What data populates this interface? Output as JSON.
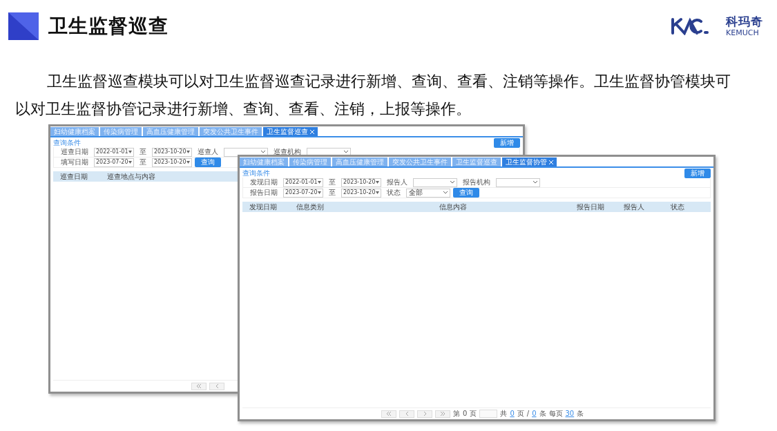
{
  "header": {
    "title": "卫生监督巡查",
    "logo_cn": "科玛奇",
    "logo_en": "KEMUCH"
  },
  "intro": "卫生监督巡查模块可以对卫生监督巡查记录进行新增、查询、查看、注销等操作。卫生监督协管模块可以对卫生监督协管记录进行新增、查询、查看、注销，上报等操作。",
  "windows": [
    {
      "tabs": [
        {
          "label": "妇幼健康档案",
          "selected": false
        },
        {
          "label": "传染病管理",
          "selected": false
        },
        {
          "label": "高血压健康管理",
          "selected": false
        },
        {
          "label": "突发公共卫生事件",
          "selected": false
        },
        {
          "label": "卫生监督巡查",
          "selected": true
        }
      ],
      "section": "查询条件",
      "add_button": "新增",
      "filters": [
        [
          {
            "kind": "label",
            "text": "巡查日期"
          },
          {
            "kind": "date",
            "text": "2022-01-01"
          },
          {
            "kind": "sep",
            "text": "至"
          },
          {
            "kind": "date",
            "text": "2023-10-20"
          },
          {
            "kind": "label",
            "text": "巡查人"
          },
          {
            "kind": "select"
          },
          {
            "kind": "label",
            "text": "巡查机构"
          },
          {
            "kind": "select"
          }
        ],
        [
          {
            "kind": "label",
            "text": "填写日期"
          },
          {
            "kind": "date",
            "text": "2023-07-20"
          },
          {
            "kind": "sep",
            "text": "至"
          },
          {
            "kind": "date",
            "text": "2023-10-20"
          },
          {
            "kind": "button",
            "text": "查询"
          }
        ]
      ],
      "columns": [
        {
          "label": "巡查日期",
          "wide": false
        },
        {
          "label": "巡查地点与内容",
          "wide": false
        }
      ],
      "pager": [
        {
          "kind": "first"
        },
        {
          "kind": "prev"
        }
      ]
    },
    {
      "tabs": [
        {
          "label": "妇幼健康档案",
          "selected": false
        },
        {
          "label": "传染病管理",
          "selected": false
        },
        {
          "label": "高血压健康管理",
          "selected": false
        },
        {
          "label": "突发公共卫生事件",
          "selected": false
        },
        {
          "label": "卫生监督巡查",
          "selected": false
        },
        {
          "label": "卫生监督协管",
          "selected": true
        }
      ],
      "section": "查询条件",
      "add_button": "新增",
      "filters": [
        [
          {
            "kind": "label",
            "text": "发现日期"
          },
          {
            "kind": "date",
            "text": "2022-01-01"
          },
          {
            "kind": "sep",
            "text": "至"
          },
          {
            "kind": "date",
            "text": "2023-10-20"
          },
          {
            "kind": "label",
            "text": "报告人"
          },
          {
            "kind": "select"
          },
          {
            "kind": "label",
            "text": "报告机构"
          },
          {
            "kind": "select"
          }
        ],
        [
          {
            "kind": "label",
            "text": "报告日期"
          },
          {
            "kind": "date",
            "text": "2023-07-20"
          },
          {
            "kind": "sep",
            "text": "至"
          },
          {
            "kind": "date",
            "text": "2023-10-20"
          },
          {
            "kind": "label",
            "text": "状态"
          },
          {
            "kind": "select",
            "text": "全部"
          },
          {
            "kind": "button",
            "text": "查询"
          }
        ]
      ],
      "columns": [
        {
          "label": "发现日期",
          "wide": false
        },
        {
          "label": "信息类别",
          "wide": false
        },
        {
          "label": "信息内容",
          "wide": true
        },
        {
          "label": "报告日期",
          "wide": false
        },
        {
          "label": "报告人",
          "wide": false
        },
        {
          "label": "状态",
          "wide": false
        }
      ],
      "pager": [
        {
          "kind": "first"
        },
        {
          "kind": "prev"
        },
        {
          "kind": "next"
        },
        {
          "kind": "last"
        },
        {
          "kind": "text",
          "text": "第"
        },
        {
          "kind": "text",
          "text": "0"
        },
        {
          "kind": "text",
          "text": "页"
        },
        {
          "kind": "input"
        },
        {
          "kind": "text",
          "text": "共"
        },
        {
          "kind": "link",
          "text": "0"
        },
        {
          "kind": "text",
          "text": "页"
        },
        {
          "kind": "text",
          "text": "/"
        },
        {
          "kind": "link",
          "text": "0"
        },
        {
          "kind": "text",
          "text": "条"
        },
        {
          "kind": "text",
          "text": "每页"
        },
        {
          "kind": "link",
          "text": "30"
        },
        {
          "kind": "text",
          "text": "条"
        }
      ]
    }
  ]
}
